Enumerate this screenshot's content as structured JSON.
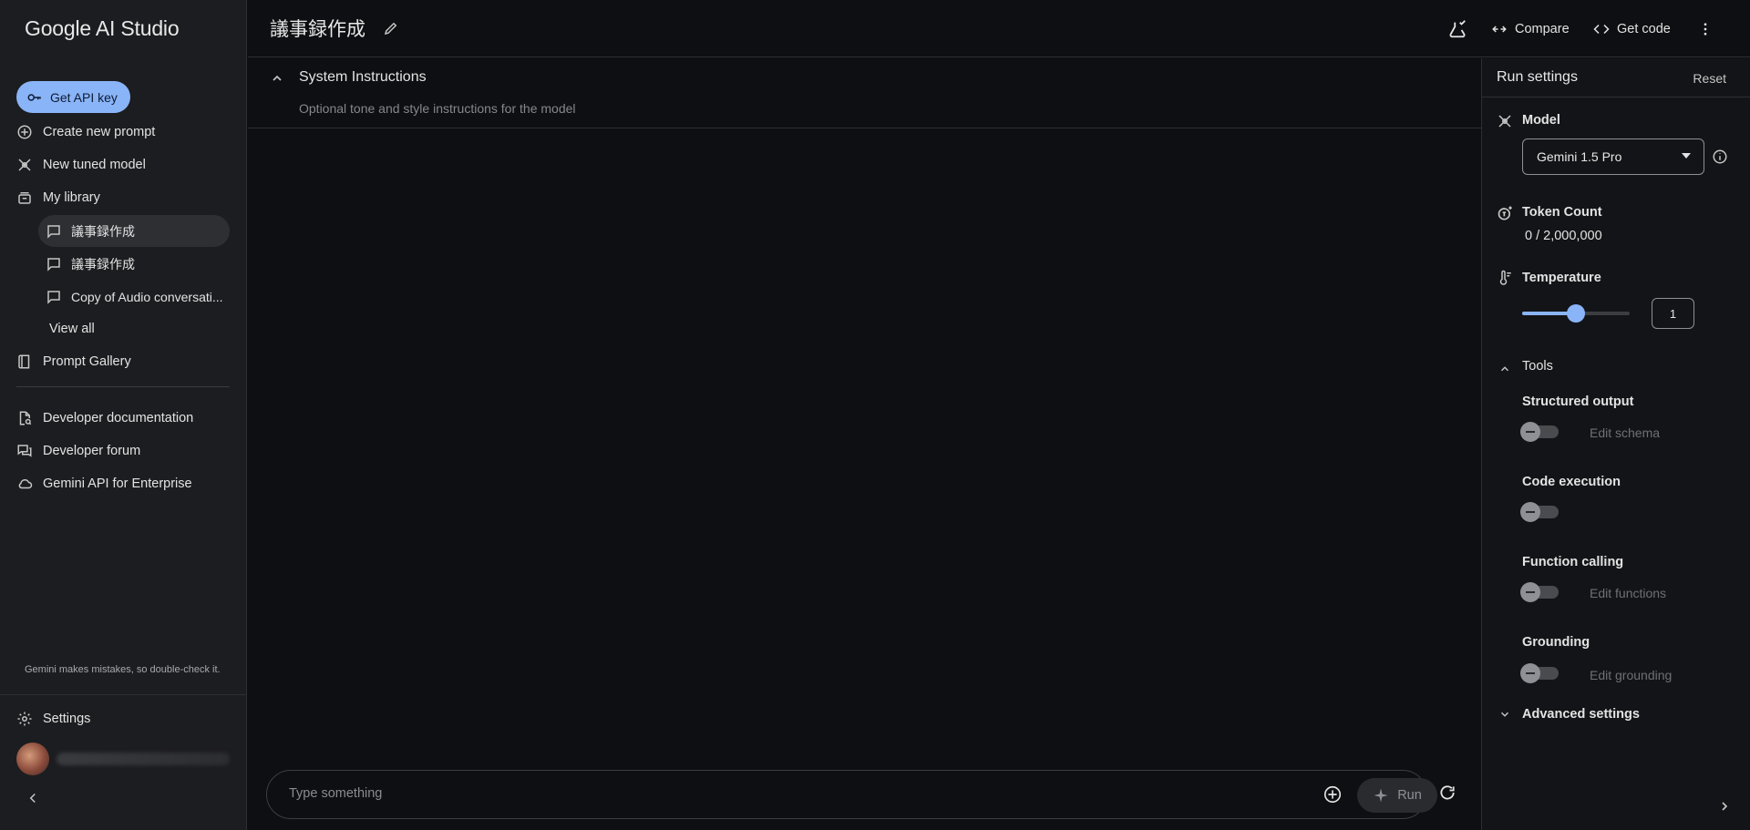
{
  "app": {
    "title": "Google AI Studio"
  },
  "sidebar": {
    "api_key_label": "Get API key",
    "items": [
      {
        "label": "Create new prompt",
        "icon": "plus-circle-icon"
      },
      {
        "label": "New tuned model",
        "icon": "tuned-model-icon"
      },
      {
        "label": "My library",
        "icon": "library-icon"
      }
    ],
    "library": [
      {
        "label": "議事録作成",
        "active": true
      },
      {
        "label": "議事録作成",
        "active": false
      },
      {
        "label": "Copy of Audio conversati...",
        "active": false
      }
    ],
    "view_all": "View all",
    "prompt_gallery": "Prompt Gallery",
    "resources": [
      {
        "label": "Developer documentation",
        "icon": "doc-search-icon"
      },
      {
        "label": "Developer forum",
        "icon": "forum-icon"
      },
      {
        "label": "Gemini API for Enterprise",
        "icon": "cloud-icon"
      }
    ],
    "disclaimer": "Gemini makes mistakes, so double-check it.",
    "settings": "Settings"
  },
  "header": {
    "prompt_title": "議事録作成",
    "compare_label": "Compare",
    "get_code_label": "Get code"
  },
  "main": {
    "system_instructions_title": "System Instructions",
    "system_instructions_placeholder": "Optional tone and style instructions for the model",
    "chat_placeholder": "Type something",
    "run_label": "Run"
  },
  "run_settings": {
    "title": "Run settings",
    "reset_label": "Reset",
    "model_label": "Model",
    "model_value": "Gemini 1.5 Pro",
    "token_count_label": "Token Count",
    "token_count_value": "0 / 2,000,000",
    "temperature_label": "Temperature",
    "temperature_value": "1",
    "temperature_fraction": 0.5,
    "tools_label": "Tools",
    "tools": [
      {
        "name": "Structured output",
        "enabled": false,
        "link": "Edit schema"
      },
      {
        "name": "Code execution",
        "enabled": false,
        "link": ""
      },
      {
        "name": "Function calling",
        "enabled": false,
        "link": "Edit functions"
      },
      {
        "name": "Grounding",
        "enabled": false,
        "link": "Edit grounding"
      }
    ],
    "advanced_label": "Advanced settings"
  },
  "colors": {
    "accent": "#8ab4f8",
    "background": "#0e0f12",
    "sidebar": "#1c1d20"
  }
}
